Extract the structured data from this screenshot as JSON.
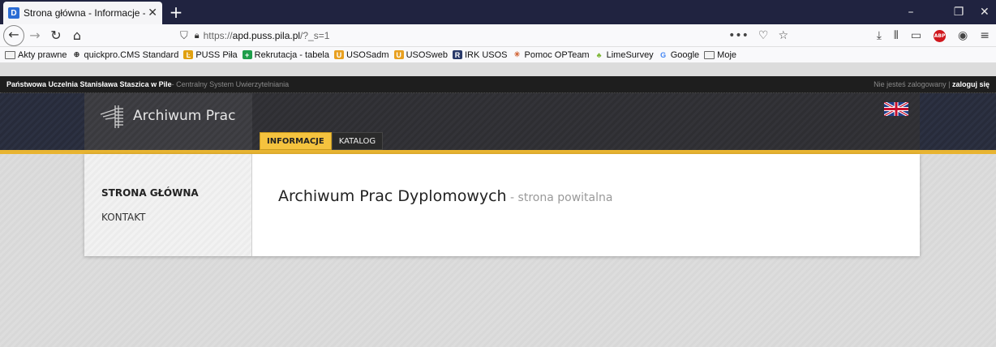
{
  "browser": {
    "tab_title": "Strona główna - Informacje - P",
    "tab_favicon": "D",
    "url_prefix": "https://",
    "url_domain": "apd.puss.pila.pl",
    "url_path": "/?_s=1",
    "page_actions": "•••",
    "bookmarks": [
      {
        "label": "Akty prawne",
        "icon": "folder-icon"
      },
      {
        "label": "quickpro.CMS Standard",
        "icon": "globe-icon"
      },
      {
        "label": "PUSS Piła",
        "icon": "puss-icon"
      },
      {
        "label": "Rekrutacja - tabela",
        "icon": "sheet-icon"
      },
      {
        "label": "USOSadm",
        "icon": "usos-icon"
      },
      {
        "label": "USOSweb",
        "icon": "usos-icon"
      },
      {
        "label": "IRK USOS",
        "icon": "irk-icon"
      },
      {
        "label": "Pomoc OPTeam",
        "icon": "star-icon"
      },
      {
        "label": "LimeSurvey",
        "icon": "lime-icon"
      },
      {
        "label": "Google",
        "icon": "google-icon"
      },
      {
        "label": "Moje",
        "icon": "folder-icon"
      }
    ]
  },
  "site": {
    "university": "Państwowa Uczelnia Stanisława Staszica w Pile",
    "system": " - Centralny System Uwierzytelniania",
    "not_logged": "Nie jesteś zalogowany | ",
    "login": "zaloguj się",
    "logo_text": "Archiwum Prac",
    "tabs": [
      "INFORMACJE",
      "KATALOG"
    ],
    "sidenav": [
      "STRONA GŁÓWNA",
      "KONTAKT"
    ],
    "title": "Archiwum Prac Dyplomowych",
    "subtitle": " - strona powitalna"
  },
  "colors": {
    "accent": "#f5c33e",
    "gold_bar": "#e8b431",
    "tabbar": "#202340"
  }
}
